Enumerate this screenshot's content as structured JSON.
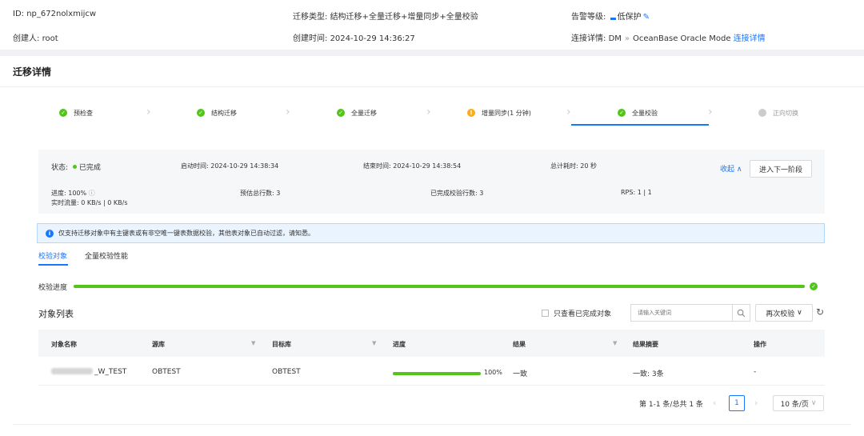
{
  "info": {
    "id_label": "ID: ",
    "id_value": "np_672nolxmijcw",
    "migration_type_label": "迁移类型: ",
    "migration_type_value": "结构迁移+全量迁移+增量同步+全量校验",
    "alert_level_label": "告警等级: ",
    "alert_level_value": "低保护",
    "creator_label": "创建人: ",
    "creator_value": "root",
    "created_time_label": "创建时间: ",
    "created_time_value": "2024-10-29 14:36:27",
    "connection_label": "连接详情: ",
    "connection_source": "DM",
    "connection_sep": "»",
    "connection_target": "OceanBase Oracle Mode",
    "connection_link": "连接详情"
  },
  "main": {
    "title": "迁移详情",
    "steps": [
      {
        "label": "预检查",
        "status": "done"
      },
      {
        "label": "结构迁移",
        "status": "done"
      },
      {
        "label": "全量迁移",
        "status": "done"
      },
      {
        "label": "增量同步(1 分钟)",
        "status": "warn"
      },
      {
        "label": "全量校验",
        "status": "done"
      },
      {
        "label": "正向切换",
        "status": "idle"
      }
    ]
  },
  "status": {
    "state_label": "状态: ",
    "state_value": "已完成",
    "start_label": "启动时间: ",
    "start_value": "2024-10-29 14:38:34",
    "end_label": "结束时间: ",
    "end_value": "2024-10-29 14:38:54",
    "duration_label": "总计耗时: ",
    "duration_value": "20 秒",
    "collapse_label": "收起",
    "next_stage_label": "进入下一阶段",
    "progress_label": "进度: ",
    "progress_value": "100%",
    "traffic_label": "实时流量: ",
    "traffic_value": "0 KB/s | 0 KB/s",
    "estimated_rows_label": "预估总行数: ",
    "estimated_rows_value": "3",
    "checked_rows_label": "已完成校验行数: ",
    "checked_rows_value": "3",
    "rps_label": "RPS: ",
    "rps_value": "1 | 1"
  },
  "alert": {
    "text": "仅支持迁移对象中有主键表或有非空唯一键表数据校验，其他表对象已自动过滤，请知悉。"
  },
  "tabs": [
    {
      "label": "校验对象",
      "active": true
    },
    {
      "label": "全量校验性能",
      "active": false
    }
  ],
  "check_progress": {
    "label": "校验进度",
    "fraction": 1.0
  },
  "object_list": {
    "title": "对象列表",
    "only_completed_label": "只查看已完成对象",
    "search_placeholder": "请输入关键词",
    "recheck_label": "再次校验",
    "columns": [
      "对象名称",
      "源库",
      "目标库",
      "进度",
      "结果",
      "结果摘要",
      "操作"
    ],
    "rows": [
      {
        "name_suffix": "_W_TEST",
        "source": "OBTEST",
        "target": "OBTEST",
        "progress_fraction": 1.0,
        "progress_text": "100%",
        "result": "一致",
        "summary": "一致: 3条",
        "action": "-"
      }
    ]
  },
  "pagination": {
    "summary": "第 1-1 条/总共 1 条",
    "current_page": "1",
    "page_size": "10 条/页"
  },
  "colors": {
    "accent": "#1677ff",
    "success": "#52c41a",
    "warning": "#faad14"
  }
}
